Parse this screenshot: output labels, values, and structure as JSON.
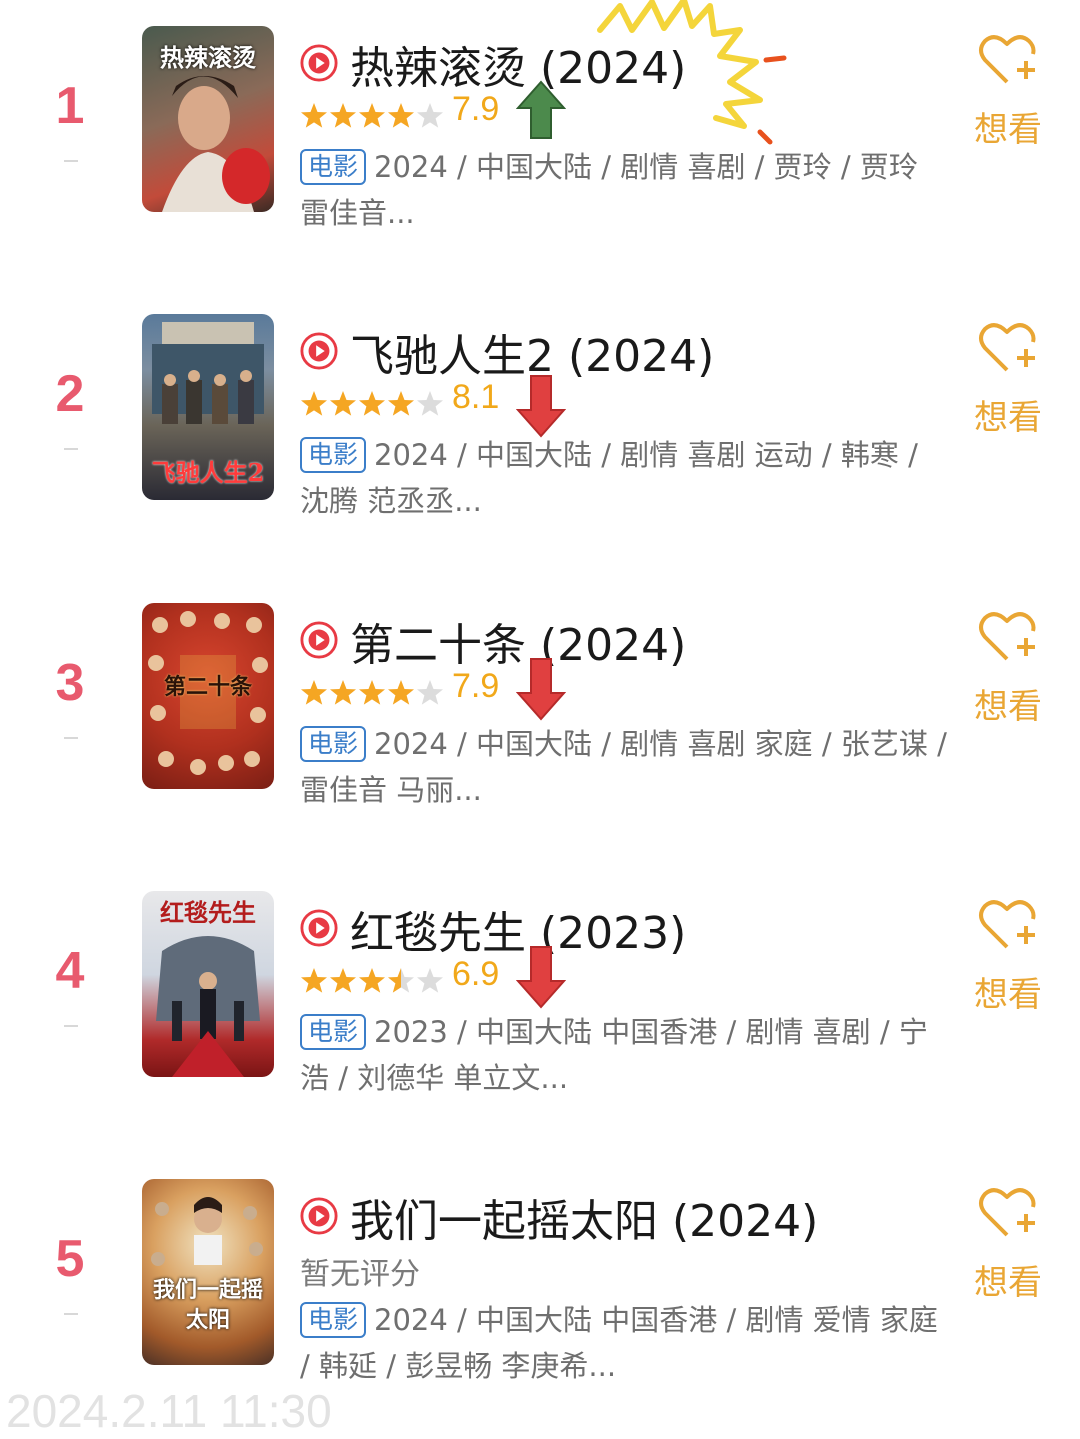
{
  "movies": [
    {
      "rank": "1",
      "title": "热辣滚烫 (2024)",
      "rating": 7.9,
      "score_text": "7.9",
      "stars_out_of_5": 4,
      "type_tag": "电影",
      "meta_line1": "2024 / 中国大陆 / 剧情 喜剧 / 贾玲 / 贾玲",
      "meta_line2": "雷佳音...",
      "want_label": "想看",
      "trend": "up",
      "poster_text": "热辣滚烫"
    },
    {
      "rank": "2",
      "title": "飞驰人生2 (2024)",
      "rating": 8.1,
      "score_text": "8.1",
      "stars_out_of_5": 4,
      "type_tag": "电影",
      "meta_line1": "2024 / 中国大陆 / 剧情 喜剧 运动 / 韩寒 /",
      "meta_line2": "沈腾 范丞丞...",
      "want_label": "想看",
      "trend": "down",
      "poster_text": "飞驰人生2"
    },
    {
      "rank": "3",
      "title": "第二十条 (2024)",
      "rating": 7.9,
      "score_text": "7.9",
      "stars_out_of_5": 4,
      "type_tag": "电影",
      "meta_line1": "2024 / 中国大陆 / 剧情 喜剧 家庭 / 张艺谋 /",
      "meta_line2": "雷佳音 马丽...",
      "want_label": "想看",
      "trend": "down",
      "poster_text": "第二十条"
    },
    {
      "rank": "4",
      "title": "红毯先生 (2023)",
      "rating": 6.9,
      "score_text": "6.9",
      "stars_out_of_5": 3.5,
      "type_tag": "电影",
      "meta_line1": "2023 / 中国大陆 中国香港 / 剧情 喜剧 / 宁",
      "meta_line2": "浩 / 刘德华 单立文...",
      "want_label": "想看",
      "trend": "down",
      "poster_text": "红毯先生"
    },
    {
      "rank": "5",
      "title": "我们一起摇太阳 (2024)",
      "rating": null,
      "no_score_text": "暂无评分",
      "stars_out_of_5": 0,
      "type_tag": "电影",
      "meta_line1": "2024 / 中国大陆 中国香港 / 剧情 爱情 家庭",
      "meta_line2": "/ 韩延 / 彭昱畅 李庚希...",
      "want_label": "想看",
      "trend": "none",
      "poster_text": "我们一起摇太阳"
    }
  ],
  "timestamp": "2024.2.11  11:30",
  "colors": {
    "rank": "#e85a6e",
    "star": "#f5a623",
    "star_empty": "#dcdcdc",
    "score": "#f1a81a",
    "want": "#e9a634",
    "tag": "#3b7ec9",
    "arrow_up": "#4c8a4c",
    "arrow_down": "#e04040"
  }
}
